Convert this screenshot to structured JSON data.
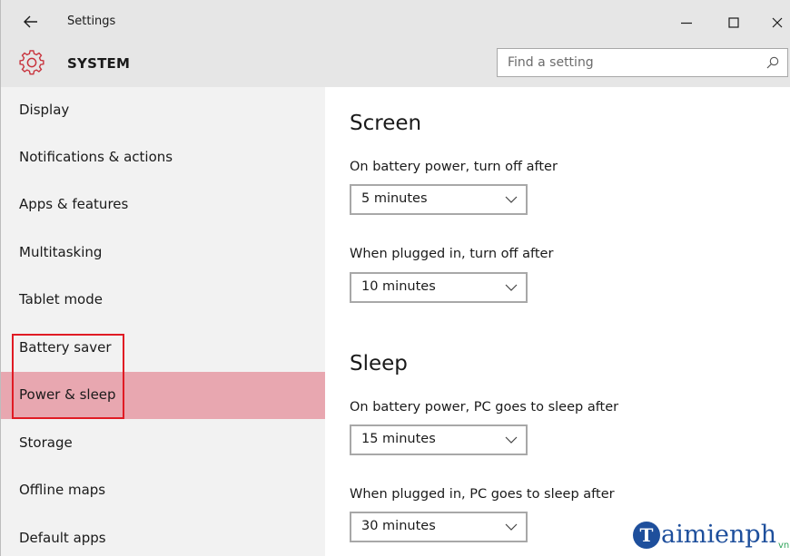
{
  "window": {
    "title": "Settings",
    "min_glyph": "—",
    "max_glyph": "☐",
    "close_glyph": "✕"
  },
  "header": {
    "section": "SYSTEM",
    "search_placeholder": "Find a setting"
  },
  "sidebar": {
    "items": [
      {
        "label": "Display"
      },
      {
        "label": "Notifications & actions"
      },
      {
        "label": "Apps & features"
      },
      {
        "label": "Multitasking"
      },
      {
        "label": "Tablet mode"
      },
      {
        "label": "Battery saver"
      },
      {
        "label": "Power & sleep",
        "active": true
      },
      {
        "label": "Storage"
      },
      {
        "label": "Offline maps"
      },
      {
        "label": "Default apps"
      }
    ]
  },
  "main": {
    "screen": {
      "title": "Screen",
      "battery_label": "On battery power, turn off after",
      "battery_value": "5 minutes",
      "plugged_label": "When plugged in, turn off after",
      "plugged_value": "10 minutes"
    },
    "sleep": {
      "title": "Sleep",
      "battery_label": "On battery power, PC goes to sleep after",
      "battery_value": "15 minutes",
      "plugged_label": "When plugged in, PC goes to sleep after",
      "plugged_value": "30 minutes"
    }
  },
  "watermark": {
    "logo_letter": "T",
    "text": "aimienph",
    "sub": "vn"
  },
  "colors": {
    "accent": "#e8a7b0",
    "highlight": "#e01b24",
    "gear": "#c8323c",
    "watermark": "#1e4f9c"
  },
  "icons": [
    "back-arrow-icon",
    "gear-icon",
    "search-icon",
    "chevron-down-icon",
    "minimize-icon",
    "maximize-icon",
    "close-icon"
  ]
}
